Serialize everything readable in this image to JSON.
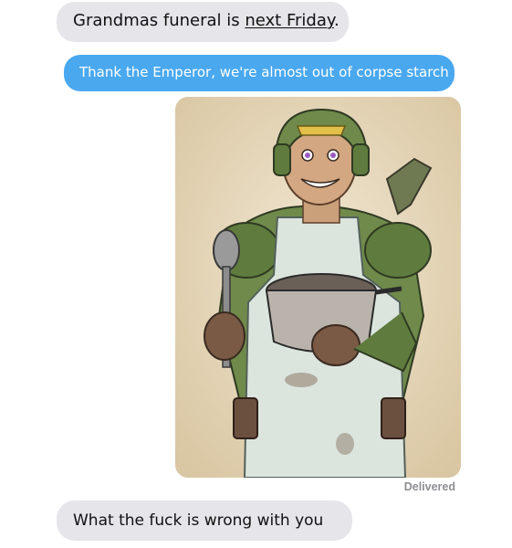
{
  "messages": [
    {
      "direction": "incoming",
      "text_before": "Grandmas funeral is ",
      "text_underlined": "next Friday",
      "text_after": "."
    },
    {
      "direction": "outgoing",
      "text": "Thank the Emperor, we're almost out of corpse starch"
    },
    {
      "direction": "incoming",
      "text": "What the fuck is wrong with you"
    }
  ],
  "status": "Delivered",
  "image": {
    "subject": "illustrated soldier in green helmet and apron holding a ladle and a pot"
  },
  "colors": {
    "incoming_bubble": "#e5e5ea",
    "outgoing_bubble": "#4aa8ef",
    "status_text": "#8e8e93"
  }
}
